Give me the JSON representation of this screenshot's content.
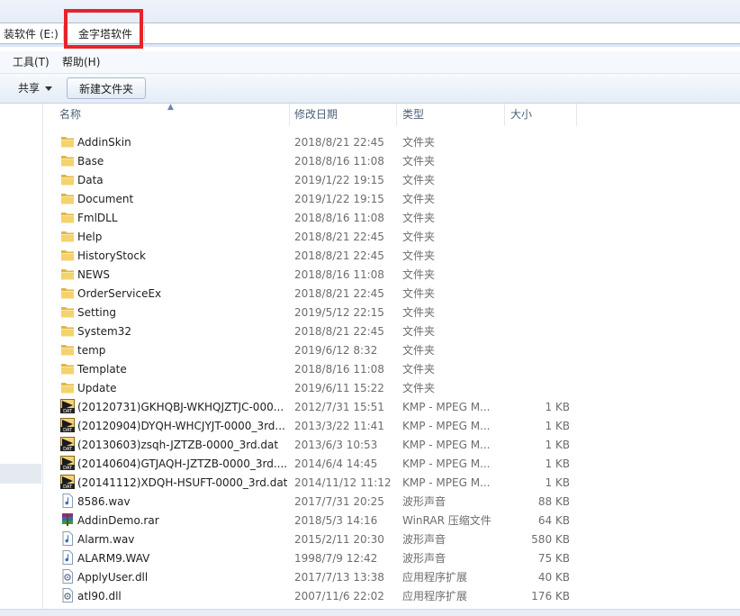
{
  "address": {
    "crumbs": [
      "装软件 (E:)",
      "金字塔软件"
    ]
  },
  "menu": [
    "工具(T)",
    "帮助(H)"
  ],
  "toolbar": {
    "share": "共享",
    "new_folder": "新建文件夹"
  },
  "columns": {
    "name": "名称",
    "date": "修改日期",
    "type": "类型",
    "size": "大小"
  },
  "files": [
    {
      "name": "AddinSkin",
      "date": "2018/8/21 22:45",
      "type": "文件夹",
      "size": "",
      "icon": "folder-icon"
    },
    {
      "name": "Base",
      "date": "2018/8/16 11:08",
      "type": "文件夹",
      "size": "",
      "icon": "folder-icon"
    },
    {
      "name": "Data",
      "date": "2019/1/22 19:15",
      "type": "文件夹",
      "size": "",
      "icon": "folder-icon"
    },
    {
      "name": "Document",
      "date": "2019/1/22 19:15",
      "type": "文件夹",
      "size": "",
      "icon": "folder-icon"
    },
    {
      "name": "FmlDLL",
      "date": "2018/8/16 11:08",
      "type": "文件夹",
      "size": "",
      "icon": "folder-icon"
    },
    {
      "name": "Help",
      "date": "2018/8/21 22:45",
      "type": "文件夹",
      "size": "",
      "icon": "folder-icon"
    },
    {
      "name": "HistoryStock",
      "date": "2018/8/21 22:45",
      "type": "文件夹",
      "size": "",
      "icon": "folder-icon"
    },
    {
      "name": "NEWS",
      "date": "2018/8/16 11:08",
      "type": "文件夹",
      "size": "",
      "icon": "folder-icon"
    },
    {
      "name": "OrderServiceEx",
      "date": "2018/8/21 22:45",
      "type": "文件夹",
      "size": "",
      "icon": "folder-icon"
    },
    {
      "name": "Setting",
      "date": "2019/5/12 22:15",
      "type": "文件夹",
      "size": "",
      "icon": "folder-icon"
    },
    {
      "name": "System32",
      "date": "2018/8/21 22:45",
      "type": "文件夹",
      "size": "",
      "icon": "folder-icon"
    },
    {
      "name": "temp",
      "date": "2019/6/12 8:32",
      "type": "文件夹",
      "size": "",
      "icon": "folder-icon"
    },
    {
      "name": "Template",
      "date": "2018/8/16 11:08",
      "type": "文件夹",
      "size": "",
      "icon": "folder-icon"
    },
    {
      "name": "Update",
      "date": "2019/6/11 15:22",
      "type": "文件夹",
      "size": "",
      "icon": "folder-icon"
    },
    {
      "name": "(20120731)GKHQBJ-WKHQJZTJC-000...",
      "date": "2012/7/31 15:51",
      "type": "KMP - MPEG M...",
      "size": "1 KB",
      "icon": "dat-file-icon"
    },
    {
      "name": "(20120904)DYQH-WHCJYJT-0000_3rd...",
      "date": "2013/3/22 11:41",
      "type": "KMP - MPEG M...",
      "size": "1 KB",
      "icon": "dat-file-icon"
    },
    {
      "name": "(20130603)zsqh-JZTZB-0000_3rd.dat",
      "date": "2013/6/3 10:53",
      "type": "KMP - MPEG M...",
      "size": "1 KB",
      "icon": "dat-file-icon"
    },
    {
      "name": "(20140604)GTJAQH-JZTZB-0000_3rd....",
      "date": "2014/6/4 14:45",
      "type": "KMP - MPEG M...",
      "size": "1 KB",
      "icon": "dat-file-icon"
    },
    {
      "name": "(20141112)XDQH-HSUFT-0000_3rd.dat",
      "date": "2014/11/12 11:12",
      "type": "KMP - MPEG M...",
      "size": "1 KB",
      "icon": "dat-file-icon"
    },
    {
      "name": "8586.wav",
      "date": "2017/7/31 20:25",
      "type": "波形声音",
      "size": "88 KB",
      "icon": "wav-file-icon"
    },
    {
      "name": "AddinDemo.rar",
      "date": "2018/5/3 14:16",
      "type": "WinRAR 压缩文件",
      "size": "64 KB",
      "icon": "rar-file-icon"
    },
    {
      "name": "Alarm.wav",
      "date": "2015/2/11 20:30",
      "type": "波形声音",
      "size": "580 KB",
      "icon": "wav-file-icon"
    },
    {
      "name": "ALARM9.WAV",
      "date": "1998/7/9 12:42",
      "type": "波形声音",
      "size": "75 KB",
      "icon": "wav-file-icon"
    },
    {
      "name": "ApplyUser.dll",
      "date": "2017/7/13 13:38",
      "type": "应用程序扩展",
      "size": "40 KB",
      "icon": "dll-file-icon"
    },
    {
      "name": "atl90.dll",
      "date": "2007/11/6 22:02",
      "type": "应用程序扩展",
      "size": "176 KB",
      "icon": "dll-file-icon"
    }
  ]
}
